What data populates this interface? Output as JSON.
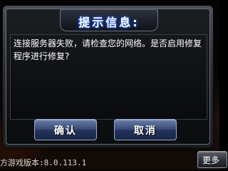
{
  "dialog": {
    "title": "提示信息:",
    "message": "连接服务器失败，请检查您的网络。是否启用修复程序进行修复?",
    "confirm_label": "确认",
    "cancel_label": "取消"
  },
  "footer": {
    "version_text": "方游戏版本:8.0.113.1",
    "more_label": "更多"
  },
  "colors": {
    "title_glow": "#2a6cff",
    "button_blue": "#3b4e7a",
    "dialog_frame": "#6a6f78"
  }
}
